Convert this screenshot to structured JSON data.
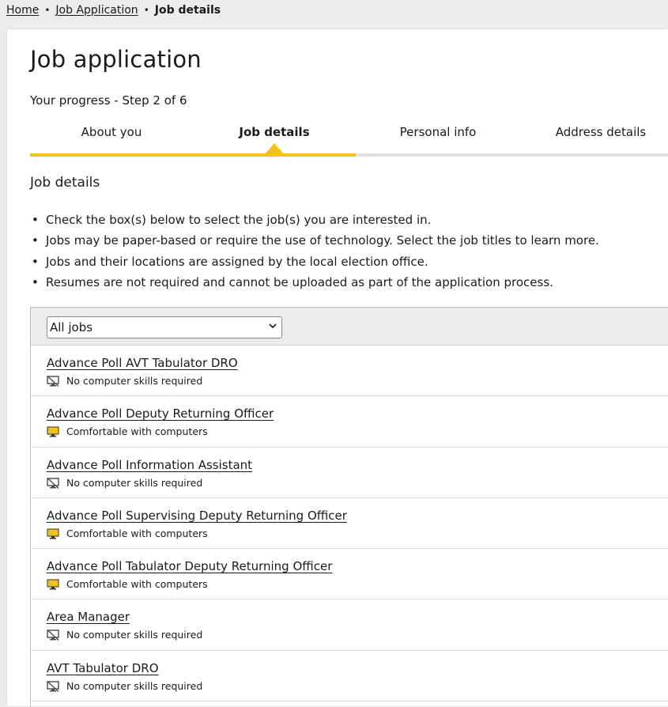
{
  "breadcrumb": {
    "items": [
      "Home",
      "Job Application"
    ],
    "current": "Job details"
  },
  "page": {
    "title": "Job application",
    "progress_label": "Your progress - Step 2 of 6"
  },
  "stepper": {
    "steps": [
      "About you",
      "Job details",
      "Personal info",
      "Address details"
    ],
    "current_step": 2,
    "total_steps": 6,
    "accent_color": "#f2c21b"
  },
  "section": {
    "title": "Job details",
    "bullets": [
      "Check the box(s) below to select the job(s) you are interested in.",
      "Jobs may be paper-based or require the use of technology. Select the job titles to learn more.",
      "Jobs and their locations are assigned by the local election office.",
      "Resumes are not required and cannot be uploaded as part of the application process."
    ]
  },
  "filter": {
    "selected": "All jobs"
  },
  "jobs": [
    {
      "title": "Advance Poll AVT Tabulator DRO",
      "skill": "No computer skills required",
      "icon": "no-computer-icon"
    },
    {
      "title": "Advance Poll Deputy Returning Officer",
      "skill": "Comfortable with computers",
      "icon": "computer-icon"
    },
    {
      "title": "Advance Poll Information Assistant",
      "skill": "No computer skills required",
      "icon": "no-computer-icon"
    },
    {
      "title": "Advance Poll Supervising Deputy Returning Officer",
      "skill": "Comfortable with computers",
      "icon": "computer-icon"
    },
    {
      "title": "Advance Poll Tabulator Deputy Returning Officer",
      "skill": "Comfortable with computers",
      "icon": "computer-icon"
    },
    {
      "title": "Area Manager",
      "skill": "No computer skills required",
      "icon": "no-computer-icon"
    },
    {
      "title": "AVT Tabulator DRO",
      "skill": "No computer skills required",
      "icon": "no-computer-icon"
    }
  ],
  "colors": {
    "computer_icon": "#f2c21b",
    "no_computer_icon": "#4a4a4a"
  }
}
